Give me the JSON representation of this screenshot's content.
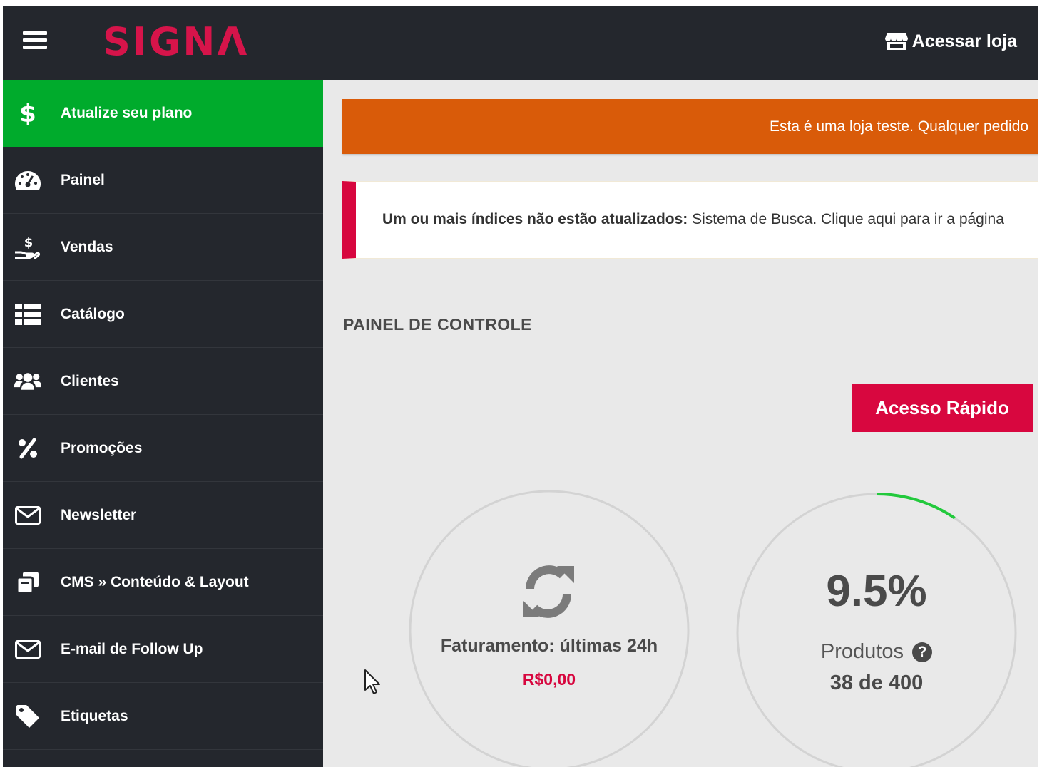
{
  "header": {
    "menu_icon": "hamburger-icon",
    "logo_text": "SIGNΛ",
    "store_link_label": "Acessar loja",
    "store_icon": "store-icon"
  },
  "sidebar": {
    "items": [
      {
        "label": "Atualize seu plano",
        "icon": "dollar-icon"
      },
      {
        "label": "Painel",
        "icon": "dashboard-gauge-icon"
      },
      {
        "label": "Vendas",
        "icon": "hand-holding-dollar-icon"
      },
      {
        "label": "Catálogo",
        "icon": "table-list-icon"
      },
      {
        "label": "Clientes",
        "icon": "users-icon"
      },
      {
        "label": "Promoções",
        "icon": "percent-icon"
      },
      {
        "label": "Newsletter",
        "icon": "envelope-icon"
      },
      {
        "label": "CMS » Conteúdo & Layout",
        "icon": "clone-icon"
      },
      {
        "label": "E-mail de Follow Up",
        "icon": "envelope-icon"
      },
      {
        "label": "Etiquetas",
        "icon": "tag-icon"
      }
    ]
  },
  "main": {
    "test_banner": "Esta é uma loja teste. Qualquer pedido",
    "alert": {
      "bold": "Um ou mais índices não estão atualizados:",
      "text": " Sistema de Busca. Clique aqui para ir a página"
    },
    "section_title": "PAINEL DE CONTROLE",
    "quick_access_label": "Acesso Rápido",
    "revenue_widget": {
      "icon": "refresh-icon",
      "caption": "Faturamento: últimas 24h",
      "value": "R$0,00"
    },
    "products_widget": {
      "percent_text": "9.5%",
      "progress_fraction": 0.095,
      "label": "Produtos",
      "help_icon": "question-circle-icon",
      "help_glyph": "?",
      "count_text": "38 de 400"
    }
  },
  "colors": {
    "topbar": "#24272d",
    "brand_red": "#d7063e",
    "upgrade_green": "#00ab2c",
    "banner_orange": "#d95b09",
    "progress_green": "#22c93c"
  }
}
